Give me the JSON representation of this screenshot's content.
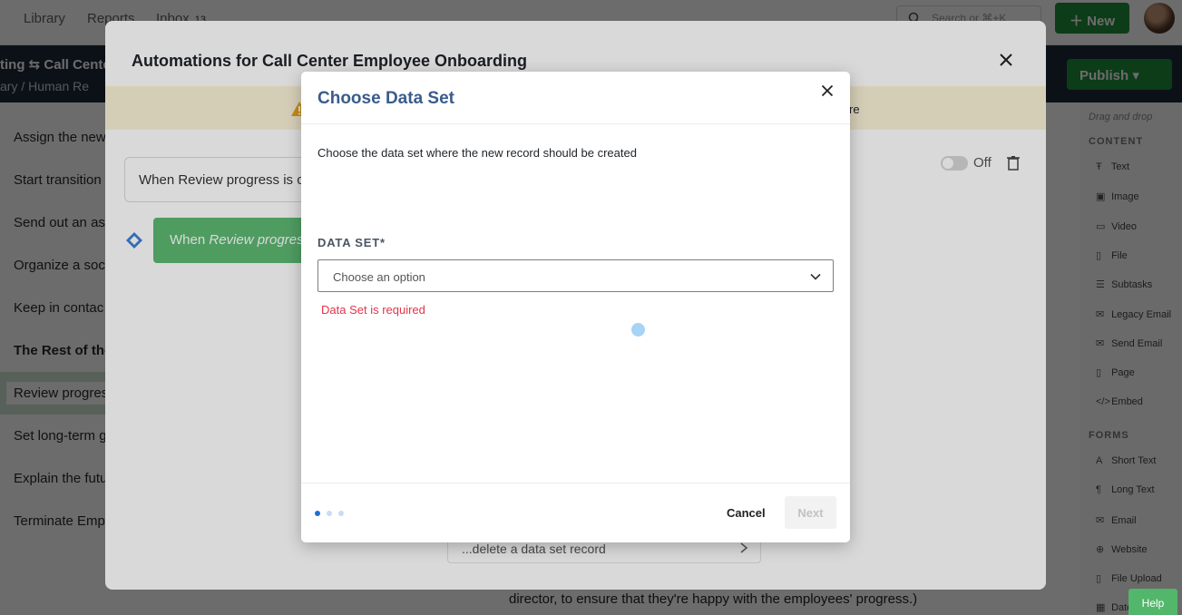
{
  "topnav": {
    "library": "Library",
    "reports": "Reports",
    "inbox": "Inbox",
    "inbox_count": "13",
    "search_placeholder": "Search or ⌘+K",
    "new_button": "New"
  },
  "subbar": {
    "crumb_title": "ting ⇆ Call Center",
    "crumb_path": "ary  /  Human Re",
    "publish": "Publish"
  },
  "sidebar": {
    "items": [
      "Assign the new",
      "Start transition",
      "Send out an as",
      "Organize a soc",
      "Keep in contac",
      "The Rest of the",
      "Review progres",
      "Set long-term g",
      "Explain the futu",
      "Terminate Emp"
    ]
  },
  "right_panel": {
    "hint": "Drag and drop",
    "content_heading": "CONTENT",
    "content_tools": [
      "Text",
      "Image",
      "Video",
      "File",
      "Subtasks",
      "Legacy Email",
      "Send Email",
      "Page",
      "Embed"
    ],
    "forms_heading": "FORMS",
    "form_tools": [
      "Short Text",
      "Long Text",
      "Email",
      "Website",
      "File Upload",
      "Date"
    ]
  },
  "background_text": "director, to ensure that they're happy with the employees' progress.)",
  "help": "Help",
  "automation_modal": {
    "title": "Automations for Call Center Employee Onboarding",
    "warning_tail": "re",
    "trigger_text": "When Review progress is c",
    "action_prefix": "When ",
    "action_italic": "Review progres",
    "toggle_label": "Off",
    "delete_row": "...delete a data set record"
  },
  "dialog": {
    "title": "Choose Data Set",
    "description": "Choose the data set where the new record should be created",
    "field_label": "DATA SET*",
    "select_placeholder": "Choose an option",
    "error": "Data Set is required",
    "cancel": "Cancel",
    "next": "Next",
    "steps": {
      "current": 1,
      "total": 3
    }
  },
  "colors": {
    "primary_green": "#1f8f3a",
    "dialog_title": "#3a5c8c",
    "error": "#e0364a",
    "step_active": "#1f6fd6",
    "step_inactive": "#c9dcf2"
  },
  "icons": [
    "search-icon",
    "plus-icon",
    "close-icon",
    "warning-icon",
    "diamond-icon",
    "trash-icon",
    "chevron-down-icon",
    "chevron-right-icon"
  ]
}
